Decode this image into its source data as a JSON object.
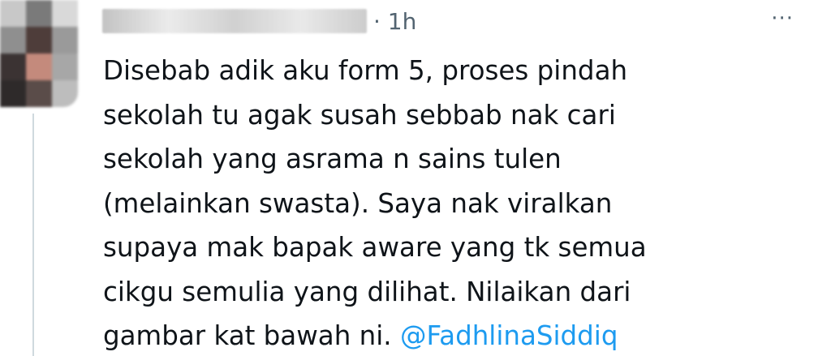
{
  "tweet": {
    "timestamp": "· 1h",
    "more_label": "···",
    "text_lines": [
      "Disebab adik aku form 5, proses pindah",
      "sekolah tu agak susah sebbab nak cari",
      "sekolah yang asrama n sains tulen",
      "(melainkan swasta). Saya nak viralkan",
      "supaya mak bapak aware yang tk semua",
      "cikgu semulia yang dilihat. Nilaikan dari",
      "gambar kat bawah ni. "
    ],
    "mention": "@FadhlinaSiddiq"
  },
  "colors": {
    "text": "#0f1419",
    "secondary": "#536471",
    "link": "#1d9bf0",
    "thread_line": "#cfd9de"
  },
  "icons": {
    "more": "more-horizontal-icon"
  }
}
